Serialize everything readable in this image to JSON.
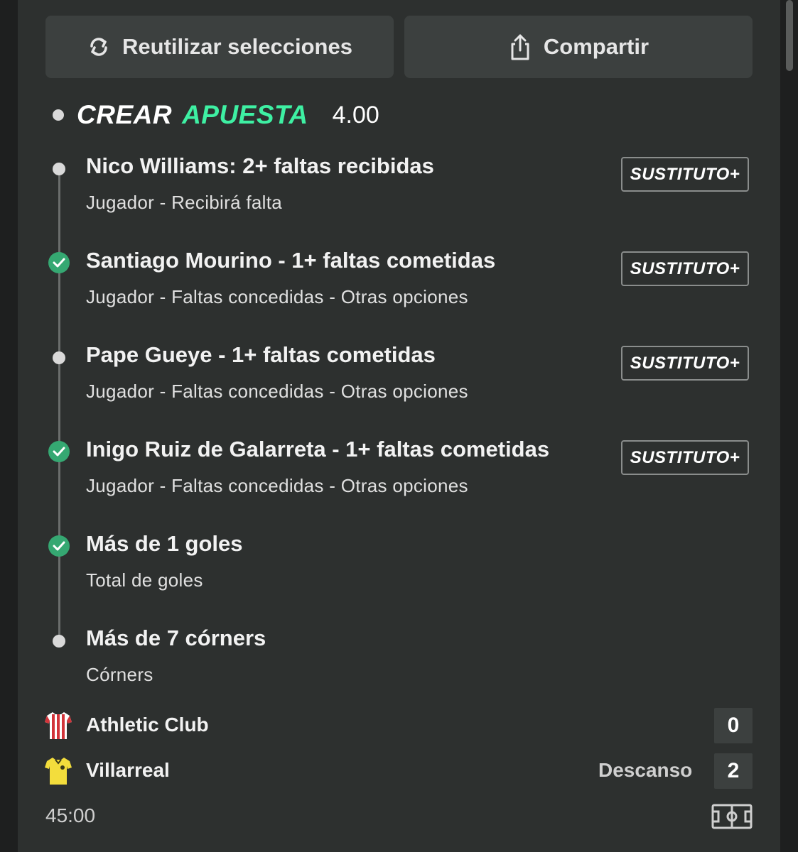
{
  "buttons": {
    "reuse_label": "Reutilizar selecciones",
    "share_label": "Compartir"
  },
  "header": {
    "title_part1": "CREAR",
    "title_part2": "APUESTA",
    "odds": "4.00",
    "accent_color": "#3ef0a3"
  },
  "legs": [
    {
      "title": "Nico Williams: 2+ faltas recibidas",
      "subtitle": "Jugador - Recibirá falta",
      "status": "pending",
      "substitute_label": "SUSTITUTO+"
    },
    {
      "title": "Santiago Mourino - 1+ faltas cometidas",
      "subtitle": "Jugador - Faltas concedidas - Otras opciones",
      "status": "won",
      "substitute_label": "SUSTITUTO+"
    },
    {
      "title": "Pape Gueye - 1+ faltas cometidas",
      "subtitle": "Jugador - Faltas concedidas - Otras opciones",
      "status": "pending",
      "substitute_label": "SUSTITUTO+"
    },
    {
      "title": "Inigo Ruiz de Galarreta - 1+ faltas cometidas",
      "subtitle": "Jugador - Faltas concedidas - Otras opciones",
      "status": "won",
      "substitute_label": "SUSTITUTO+"
    },
    {
      "title": "Más de 1 goles",
      "subtitle": "Total de goles",
      "status": "won"
    },
    {
      "title": "Más de 7 córners",
      "subtitle": "Córners",
      "status": "pending"
    }
  ],
  "match": {
    "home": {
      "name": "Athletic Club",
      "score": "0",
      "shirt_icon": "athletic-shirt-icon"
    },
    "away": {
      "name": "Villarreal",
      "score": "2",
      "shirt_icon": "villarreal-shirt-icon"
    },
    "status": "Descanso",
    "clock": "45:00"
  },
  "colors": {
    "won": "#35a872",
    "pending": "#d9d9d9"
  }
}
